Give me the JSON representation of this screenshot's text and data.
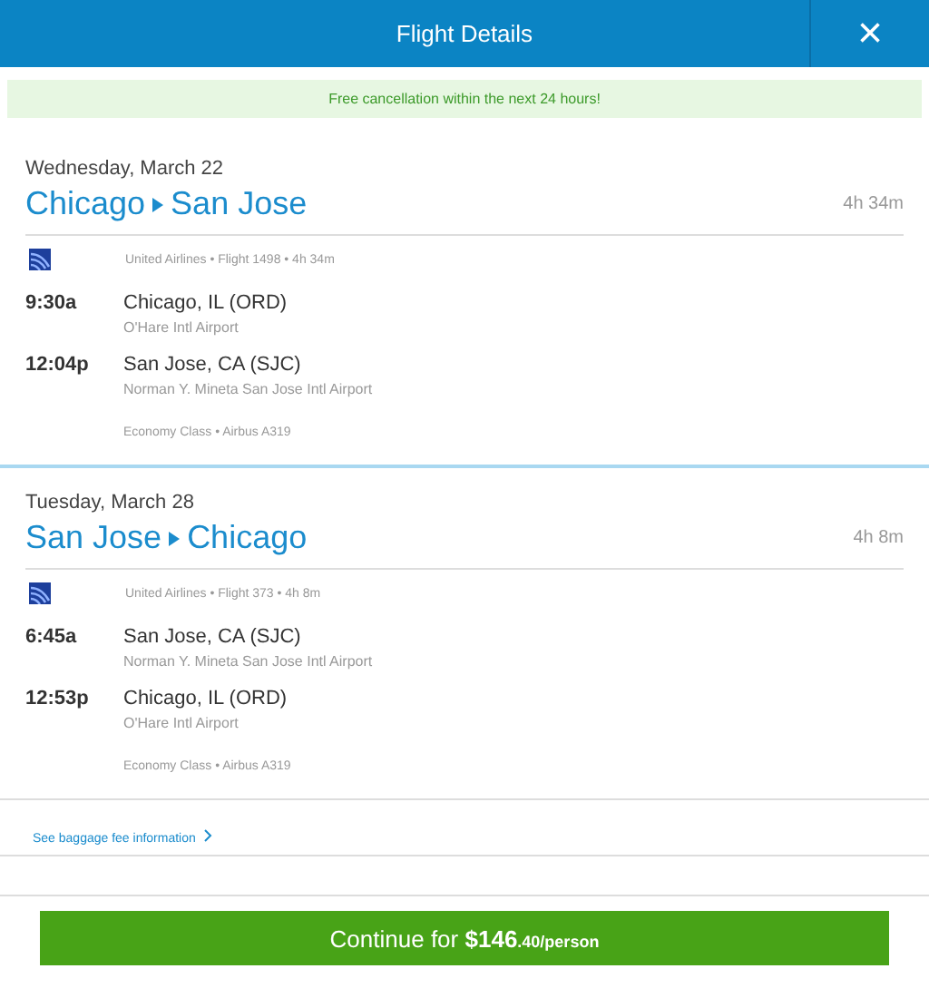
{
  "header": {
    "title": "Flight Details",
    "close": "×"
  },
  "banner": "Free cancellation within the next 24 hours!",
  "legs": [
    {
      "date": "Wednesday, March 22",
      "origin": "Chicago",
      "destination": "San Jose",
      "duration": "4h 34m",
      "flight_info": "United Airlines • Flight 1498 • 4h 34m",
      "stops": [
        {
          "time": "9:30a",
          "city": "Chicago, IL (ORD)",
          "airport": "O'Hare Intl Airport"
        },
        {
          "time": "12:04p",
          "city": "San Jose, CA (SJC)",
          "airport": "Norman Y. Mineta San Jose Intl Airport"
        }
      ],
      "cabin": "Economy Class • Airbus A319"
    },
    {
      "date": "Tuesday, March 28",
      "origin": "San Jose",
      "destination": "Chicago",
      "duration": "4h 8m",
      "flight_info": "United Airlines • Flight 373 • 4h 8m",
      "stops": [
        {
          "time": "6:45a",
          "city": "San Jose, CA (SJC)",
          "airport": "Norman Y. Mineta San Jose Intl Airport"
        },
        {
          "time": "12:53p",
          "city": "Chicago, IL (ORD)",
          "airport": "O'Hare Intl Airport"
        }
      ],
      "cabin": "Economy Class • Airbus A319"
    }
  ],
  "baggage_link": "See baggage fee information",
  "continue_button": {
    "label": "Continue for",
    "price": "$146",
    "cents": ".40/person"
  }
}
